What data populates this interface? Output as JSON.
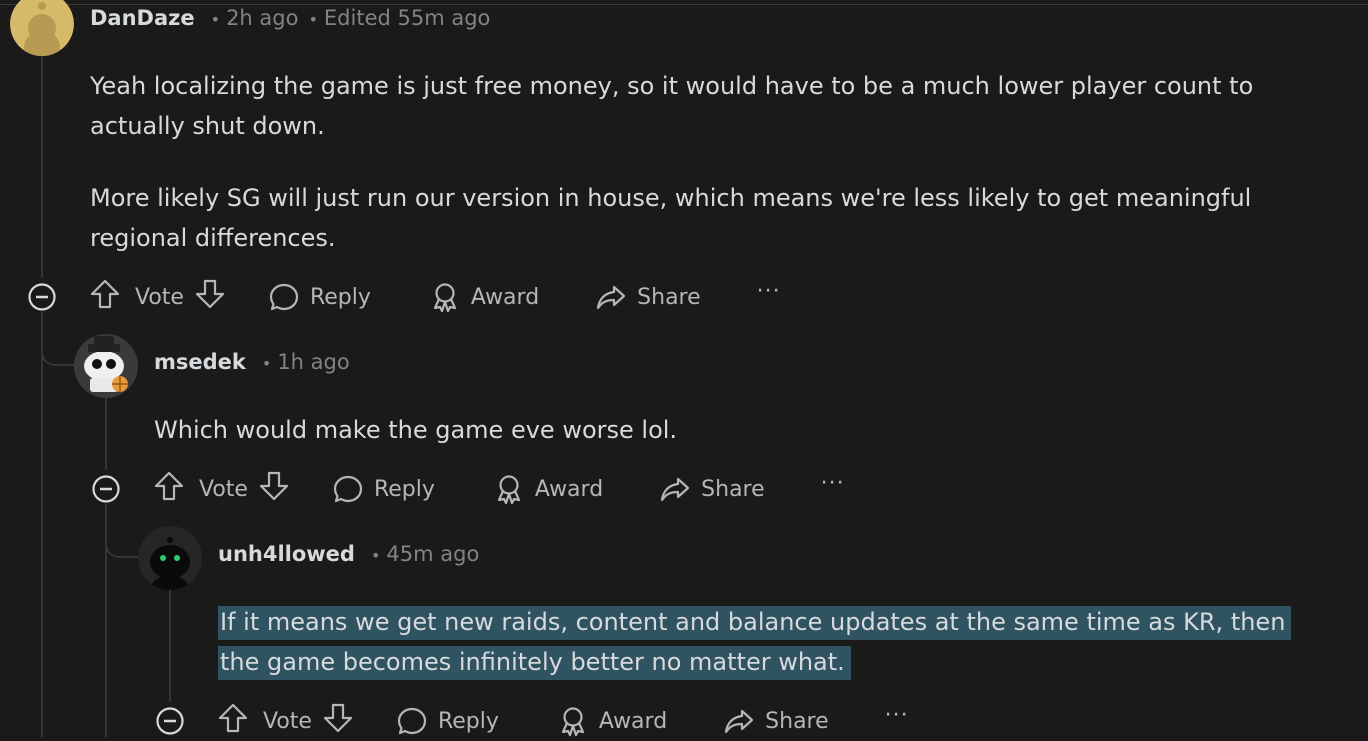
{
  "comments": [
    {
      "username": "DanDaze",
      "time": "2h ago",
      "edited": "Edited 55m ago",
      "paragraphs": [
        "Yeah localizing the game is just free money, so it would have to be a much lower player count to actually shut down.",
        "More likely SG will just run our version in house, which means we're less likely to get meaningful regional differences."
      ],
      "avatar_color": "#d7b96a"
    },
    {
      "username": "msedek",
      "time": "1h ago",
      "paragraphs": [
        "Which would make the game eve worse lol."
      ]
    },
    {
      "username": "unh4llowed",
      "time": "45m ago",
      "paragraphs": [
        "If it means we get new raids, content and balance updates at the same time as KR, then the game becomes infinitely better no matter what."
      ],
      "selection_color": "#2f5361"
    }
  ],
  "actions": {
    "vote": "Vote",
    "reply": "Reply",
    "award": "Award",
    "share": "Share",
    "more": "···"
  },
  "meta_separator": "•",
  "colors": {
    "background": "#1a1a1b",
    "text": "#d7dadc",
    "muted": "#818384",
    "thread_line": "#343536"
  },
  "icons": [
    "collapse-icon",
    "upvote-icon",
    "downvote-icon",
    "reply-icon",
    "award-icon",
    "share-icon",
    "more-icon"
  ]
}
